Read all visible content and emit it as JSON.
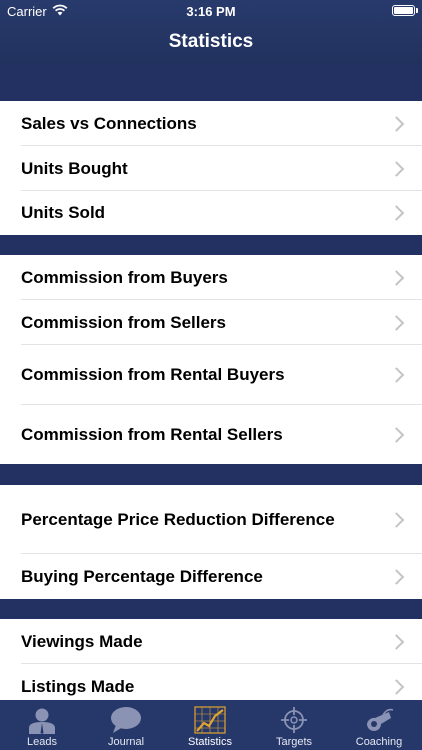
{
  "status_bar": {
    "carrier": "Carrier",
    "time": "3:16 PM"
  },
  "nav": {
    "title": "Statistics"
  },
  "sections": [
    {
      "rows": [
        {
          "label": "Sales vs Connections"
        },
        {
          "label": "Units Bought"
        },
        {
          "label": "Units Sold"
        }
      ]
    },
    {
      "rows": [
        {
          "label": "Commission from Buyers"
        },
        {
          "label": "Commission from Sellers"
        },
        {
          "label": "Commission from Rental Buyers"
        },
        {
          "label": "Commission from Rental Sellers"
        }
      ]
    },
    {
      "rows": [
        {
          "label": "Percentage Price Reduction Difference"
        },
        {
          "label": "Buying Percentage Difference"
        }
      ]
    },
    {
      "rows": [
        {
          "label": "Viewings Made"
        },
        {
          "label": "Listings Made"
        }
      ]
    }
  ],
  "tabbar": {
    "tabs": [
      {
        "label": "Leads",
        "icon": "person-icon"
      },
      {
        "label": "Journal",
        "icon": "speech-bubble-icon"
      },
      {
        "label": "Statistics",
        "icon": "chart-icon",
        "active": true
      },
      {
        "label": "Targets",
        "icon": "crosshair-icon"
      },
      {
        "label": "Coaching",
        "icon": "whistle-icon"
      }
    ]
  },
  "colors": {
    "nav": "#283a6c",
    "section_gap": "#223062",
    "tab_active": "#e1a430",
    "tab_icon": "#8a93b3"
  }
}
